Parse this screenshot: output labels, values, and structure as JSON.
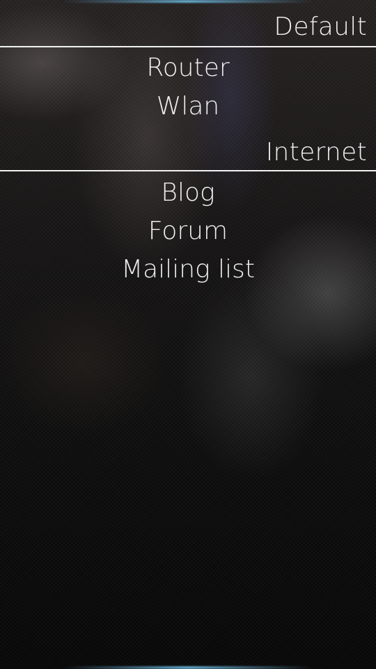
{
  "sections": [
    {
      "header": "Default",
      "items": [
        "Router",
        "Wlan"
      ]
    },
    {
      "header": "Internet",
      "items": [
        "Blog",
        "Forum",
        "Mailing list"
      ]
    }
  ],
  "colors": {
    "text": "#efefef",
    "divider": "#f2f2f2",
    "accent_glow": "#6ebee6",
    "background": "#0b0b0b"
  }
}
